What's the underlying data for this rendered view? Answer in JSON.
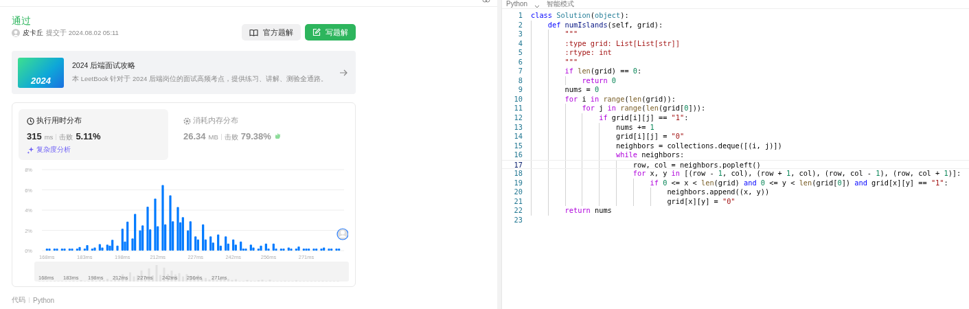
{
  "result": {
    "status": "通过",
    "user": "皮卡丘",
    "submitted": "提交于 2024.08.02 05:11"
  },
  "actions": [
    {
      "kind": "secondary",
      "label": "官方题解"
    },
    {
      "kind": "primary",
      "label": "写题解"
    }
  ],
  "promo": {
    "title": "2024 后端面试攻略",
    "description": "本 LeetBook 针对于 2024 后端岗位的面试高频考点，提供练习、讲解、测验全通路。",
    "cover_text": "2024"
  },
  "stats": [
    {
      "kind": "time",
      "selected": true,
      "title": "执行用时分布",
      "value": "315",
      "unit": "ms",
      "beat_label": "击败",
      "beat": "5.11%",
      "link": "复杂度分析"
    },
    {
      "kind": "memory",
      "selected": false,
      "title": "消耗内存分布",
      "value": "26.34",
      "unit": "MB",
      "beat_label": "击败",
      "beat": "79.38%"
    }
  ],
  "chart_data": {
    "type": "bar",
    "grid": true,
    "yticks": [
      {
        "value": 0,
        "label": "0%"
      },
      {
        "value": 2,
        "label": "2%"
      },
      {
        "value": 4,
        "label": "4%"
      },
      {
        "value": 6,
        "label": "6%"
      },
      {
        "value": 8,
        "label": "8%"
      }
    ],
    "ylim": [
      0,
      8
    ],
    "xlim": [
      166,
      286
    ],
    "x": [
      168,
      169,
      171,
      172,
      174,
      175,
      177,
      178,
      180,
      181,
      183,
      184,
      186,
      187,
      189,
      190,
      192,
      193,
      194,
      196,
      198,
      199,
      200,
      202,
      203,
      205,
      206,
      208,
      209,
      211,
      212,
      214,
      215,
      217,
      218,
      220,
      221,
      222,
      224,
      225,
      227,
      228,
      230,
      231,
      233,
      234,
      236,
      237,
      239,
      240,
      242,
      243,
      245,
      246,
      247,
      249,
      250,
      252,
      253,
      255,
      256,
      258,
      259,
      261,
      262,
      264,
      265,
      267,
      268,
      270,
      271,
      272,
      274,
      275,
      277,
      278,
      280,
      281,
      283,
      284
    ],
    "xticks": [
      {
        "value": 168,
        "label": "168ms"
      },
      {
        "value": 183,
        "label": "183ms"
      },
      {
        "value": 198,
        "label": "198ms"
      },
      {
        "value": 212,
        "label": "212ms"
      },
      {
        "value": 227,
        "label": "227ms"
      },
      {
        "value": 242,
        "label": "242ms"
      },
      {
        "value": 256,
        "label": "256ms"
      },
      {
        "value": 271,
        "label": "271ms"
      }
    ],
    "series": [
      {
        "color": "#007aff",
        "values": [
          0.2,
          0.2,
          0.2,
          0.2,
          0.2,
          0.2,
          0.2,
          0.2,
          0.2,
          0.35,
          0.2,
          0.55,
          0.2,
          0.3,
          0.65,
          0.3,
          0.6,
          0.5,
          1.07,
          0.5,
          2.17,
          0.9,
          2.86,
          1.2,
          3.63,
          2.0,
          2.5,
          4.34,
          2.1,
          5.14,
          2.4,
          6.47,
          2.6,
          5.46,
          2.9,
          4.3,
          2.8,
          3.3,
          2.0,
          2.9,
          1.4,
          1.1,
          2.6,
          1.1,
          1.4,
          0.8,
          1.6,
          0.5,
          1.4,
          0.7,
          1.1,
          0.6,
          0.9,
          0.2,
          0.2,
          0.6,
          0.3,
          0.2,
          0.5,
          0.7,
          0.2,
          0.7,
          0.2,
          0.2,
          0.2,
          0.3,
          0.2,
          0.2,
          0.4,
          0.2,
          0.2,
          0.2,
          0.2,
          0.2,
          0.2,
          0.3,
          0.2,
          0.2,
          0.2,
          0.2
        ]
      }
    ]
  },
  "brush_labels": [
    "168ms",
    "183ms",
    "198ms",
    "212ms",
    "227ms",
    "242ms",
    "256ms",
    "271ms"
  ],
  "footer": {
    "label": "代码",
    "language": "Python"
  },
  "editor": {
    "language": "Python",
    "mode": "智能模式",
    "lines": [
      {
        "no": "1",
        "current": false,
        "tokens": [
          {
            "kind": "kw",
            "text": "class "
          },
          {
            "kind": "cls",
            "text": "Solution"
          },
          {
            "kind": "p",
            "text": "("
          },
          {
            "kind": "cls",
            "text": "object"
          },
          {
            "kind": "p",
            "text": "):"
          }
        ]
      },
      {
        "no": "2",
        "current": false,
        "tokens": [
          {
            "kind": "kw",
            "text": "    def "
          },
          {
            "kind": "fn",
            "text": "numIslands"
          },
          {
            "kind": "p",
            "text": "(self, grid):"
          }
        ]
      },
      {
        "no": "3",
        "current": false,
        "tokens": [
          {
            "kind": "str",
            "text": "        \"\"\""
          }
        ]
      },
      {
        "no": "4",
        "current": false,
        "tokens": [
          {
            "kind": "str",
            "text": "        :type grid: List[List[str]]"
          }
        ]
      },
      {
        "no": "5",
        "current": false,
        "tokens": [
          {
            "kind": "str",
            "text": "        :rtype: int"
          }
        ]
      },
      {
        "no": "6",
        "current": false,
        "tokens": [
          {
            "kind": "str",
            "text": "        \"\"\""
          }
        ]
      },
      {
        "no": "7",
        "current": false,
        "tokens": [
          {
            "kind": "ctl",
            "text": "        if "
          },
          {
            "kind": "bi",
            "text": "len"
          },
          {
            "kind": "p",
            "text": "(grid) == "
          },
          {
            "kind": "num",
            "text": "0"
          },
          {
            "kind": "p",
            "text": ":"
          }
        ]
      },
      {
        "no": "8",
        "current": false,
        "tokens": [
          {
            "kind": "ctl",
            "text": "            return "
          },
          {
            "kind": "num",
            "text": "0"
          }
        ]
      },
      {
        "no": "9",
        "current": false,
        "tokens": [
          {
            "kind": "p",
            "text": "        nums = "
          },
          {
            "kind": "num",
            "text": "0"
          }
        ]
      },
      {
        "no": "10",
        "current": false,
        "tokens": [
          {
            "kind": "ctl",
            "text": "        for "
          },
          {
            "kind": "p",
            "text": "i "
          },
          {
            "kind": "ctl",
            "text": "in "
          },
          {
            "kind": "bi",
            "text": "range"
          },
          {
            "kind": "p",
            "text": "("
          },
          {
            "kind": "bi",
            "text": "len"
          },
          {
            "kind": "p",
            "text": "(grid)):"
          }
        ]
      },
      {
        "no": "11",
        "current": false,
        "tokens": [
          {
            "kind": "ctl",
            "text": "            for "
          },
          {
            "kind": "p",
            "text": "j "
          },
          {
            "kind": "ctl",
            "text": "in "
          },
          {
            "kind": "bi",
            "text": "range"
          },
          {
            "kind": "p",
            "text": "("
          },
          {
            "kind": "bi",
            "text": "len"
          },
          {
            "kind": "p",
            "text": "(grid["
          },
          {
            "kind": "num",
            "text": "0"
          },
          {
            "kind": "p",
            "text": "])):"
          }
        ]
      },
      {
        "no": "12",
        "current": false,
        "tokens": [
          {
            "kind": "ctl",
            "text": "                if "
          },
          {
            "kind": "p",
            "text": "grid[i][j] == "
          },
          {
            "kind": "str",
            "text": "\"1\""
          },
          {
            "kind": "p",
            "text": ":"
          }
        ]
      },
      {
        "no": "13",
        "current": false,
        "tokens": [
          {
            "kind": "p",
            "text": "                    nums += "
          },
          {
            "kind": "num",
            "text": "1"
          }
        ]
      },
      {
        "no": "14",
        "current": false,
        "tokens": [
          {
            "kind": "p",
            "text": "                    grid[i][j] = "
          },
          {
            "kind": "str",
            "text": "\"0\""
          }
        ]
      },
      {
        "no": "15",
        "current": false,
        "tokens": [
          {
            "kind": "p",
            "text": "                    neighbors = collections.deque([(i, j)])"
          }
        ]
      },
      {
        "no": "16",
        "current": false,
        "tokens": [
          {
            "kind": "ctl",
            "text": "                    while "
          },
          {
            "kind": "p",
            "text": "neighbors:"
          }
        ]
      },
      {
        "no": "17",
        "current": true,
        "tokens": [
          {
            "kind": "p",
            "text": "                        row, col = neighbors.popleft()"
          }
        ]
      },
      {
        "no": "18",
        "current": false,
        "tokens": [
          {
            "kind": "ctl",
            "text": "                        for "
          },
          {
            "kind": "p",
            "text": "x, y "
          },
          {
            "kind": "ctl",
            "text": "in "
          },
          {
            "kind": "p",
            "text": "[(row - "
          },
          {
            "kind": "num",
            "text": "1"
          },
          {
            "kind": "p",
            "text": ", col), (row + "
          },
          {
            "kind": "num",
            "text": "1"
          },
          {
            "kind": "p",
            "text": ", col), (row, col - "
          },
          {
            "kind": "num",
            "text": "1"
          },
          {
            "kind": "p",
            "text": "), (row, col + "
          },
          {
            "kind": "num",
            "text": "1"
          },
          {
            "kind": "p",
            "text": ")]:"
          }
        ]
      },
      {
        "no": "19",
        "current": false,
        "tokens": [
          {
            "kind": "ctl",
            "text": "                            if "
          },
          {
            "kind": "num",
            "text": "0"
          },
          {
            "kind": "p",
            "text": " <= x < "
          },
          {
            "kind": "bi",
            "text": "len"
          },
          {
            "kind": "p",
            "text": "(grid) "
          },
          {
            "kind": "kw",
            "text": "and "
          },
          {
            "kind": "num",
            "text": "0"
          },
          {
            "kind": "p",
            "text": " <= y < "
          },
          {
            "kind": "bi",
            "text": "len"
          },
          {
            "kind": "p",
            "text": "(grid["
          },
          {
            "kind": "num",
            "text": "0"
          },
          {
            "kind": "p",
            "text": "]) "
          },
          {
            "kind": "kw",
            "text": "and "
          },
          {
            "kind": "p",
            "text": "grid[x][y] == "
          },
          {
            "kind": "str",
            "text": "\"1\""
          },
          {
            "kind": "p",
            "text": ":"
          }
        ]
      },
      {
        "no": "20",
        "current": false,
        "tokens": [
          {
            "kind": "p",
            "text": "                                neighbors.append((x, y))"
          }
        ]
      },
      {
        "no": "21",
        "current": false,
        "tokens": [
          {
            "kind": "p",
            "text": "                                grid[x][y] = "
          },
          {
            "kind": "str",
            "text": "\"0\""
          }
        ]
      },
      {
        "no": "22",
        "current": false,
        "tokens": [
          {
            "kind": "ctl",
            "text": "        return "
          },
          {
            "kind": "p",
            "text": "nums"
          }
        ]
      },
      {
        "no": "23",
        "current": false
      }
    ]
  }
}
